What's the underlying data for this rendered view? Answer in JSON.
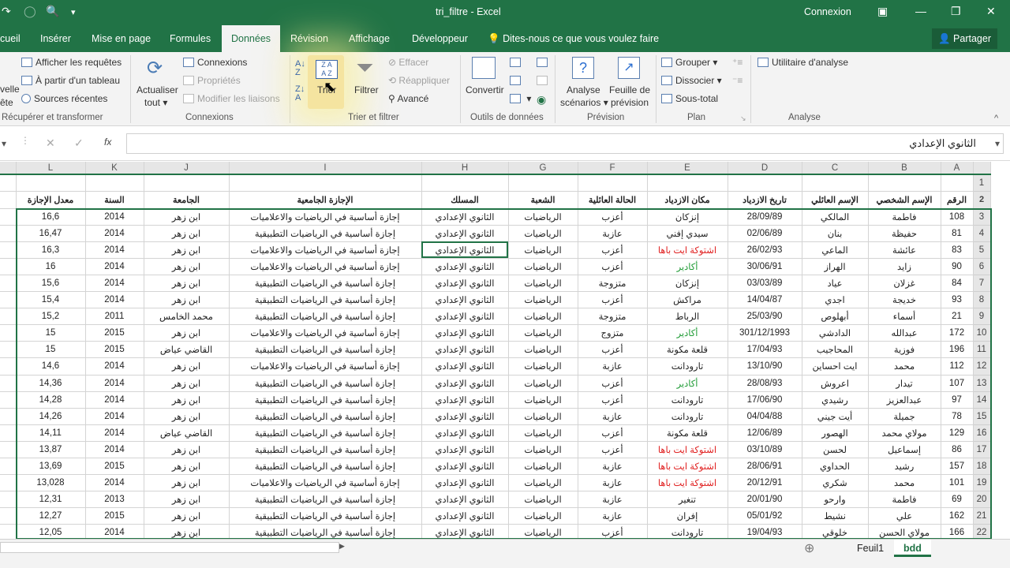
{
  "titlebar": {
    "doc_title": "tri_filtre  -  Excel",
    "signin": "Connexion"
  },
  "tabs": [
    "cueil",
    "Insérer",
    "Mise en page",
    "Formules",
    "Données",
    "Révision",
    "Affichage",
    "Développeur"
  ],
  "tell_me": "Dites-nous ce que vous voulez faire",
  "share": "Partager",
  "ribbon": {
    "nouvelle": "velle",
    "requete": "ête",
    "afficher_requetes": "Afficher les requêtes",
    "a_partir_tableau": "À partir d'un tableau",
    "sources_recentes": "Sources récentes",
    "actualiser": "Actualiser",
    "tout": "tout",
    "connexions": "Connexions",
    "proprietes": "Propriétés",
    "modifier_liaisons": "Modifier les liaisons",
    "trier": "Trier",
    "filtrer": "Filtrer",
    "effacer": "Effacer",
    "reappliquer": "Réappliquer",
    "avance": "Avancé",
    "convertir": "Convertir",
    "analyse": "Analyse",
    "scenarios": "scénarios",
    "feuille_de": "Feuille de",
    "prevision": "prévision",
    "grouper": "Grouper",
    "dissocier": "Dissocier",
    "sous_total": "Sous-total",
    "utilitaire": "Utilitaire d'analyse",
    "groups": {
      "recuperer": "Récupérer et transformer",
      "connexions": "Connexions",
      "trier_filtrer": "Trier et filtrer",
      "outils": "Outils de données",
      "prevision": "Prévision",
      "plan": "Plan",
      "analyse": "Analyse"
    }
  },
  "formula": {
    "fx": "fx",
    "value": "الثانوي الإعدادي"
  },
  "columns": [
    "L",
    "K",
    "J",
    "I",
    "H",
    "G",
    "F",
    "E",
    "D",
    "C",
    "B",
    "A"
  ],
  "headers": [
    "معدل الإجازة",
    "السنة",
    "الجامعة",
    "الإجازة الجامعية",
    "المسلك",
    "الشعبة",
    "الحالة العائلية",
    "مكان الازدياد",
    "تاريخ الازدياد",
    "الإسم العائلي",
    "الإسم الشخصي",
    "الرقم"
  ],
  "rows": [
    [
      "16,6",
      "2014",
      "ابن زهر",
      "إجازة أساسية في الرياضيات والاعلاميات",
      "الثانوي الإعدادي",
      "الرياضيات",
      "أعزب",
      "إنزكان",
      "28/09/89",
      "المالكي",
      "فاطمة",
      "108"
    ],
    [
      "16,47",
      "2014",
      "ابن زهر",
      "إجازة أساسية في الرياضيات التطبيقية",
      "الثانوي الإعدادي",
      "الرياضيات",
      "عازبة",
      "سيدي إفني",
      "02/06/89",
      "بنان",
      "حفيظة",
      "81"
    ],
    [
      "16,3",
      "2014",
      "ابن زهر",
      "إجازة أساسية في الرياضيات والاعلاميات",
      "الثانوي الإعدادي",
      "الرياضيات",
      "أعزب",
      "اشتوكة ايت باها",
      "26/02/93",
      "الماعي",
      "عائشة",
      "83"
    ],
    [
      "16",
      "2014",
      "ابن زهر",
      "إجازة أساسية في الرياضيات والاعلاميات",
      "الثانوي الإعدادي",
      "الرياضيات",
      "أعزب",
      "أكادير",
      "30/06/91",
      "الهراز",
      "زايد",
      "90"
    ],
    [
      "15,6",
      "2014",
      "ابن زهر",
      "إجازة أساسية في الرياضيات التطبيقية",
      "الثانوي الإعدادي",
      "الرياضيات",
      "متزوجة",
      "إنزكان",
      "03/03/89",
      "عياد",
      "غزلان",
      "84"
    ],
    [
      "15,4",
      "2014",
      "ابن زهر",
      "إجازة أساسية في الرياضيات التطبيقية",
      "الثانوي الإعدادي",
      "الرياضيات",
      "أعزب",
      "مراكش",
      "14/04/87",
      "اجدي",
      "خديجة",
      "93"
    ],
    [
      "15,2",
      "2011",
      "محمد الخامس",
      "إجازة أساسية في الرياضيات التطبيقية",
      "الثانوي الإعدادي",
      "الرياضيات",
      "متزوجة",
      "الرباط",
      "25/03/90",
      "أبهلوص",
      "أسماء",
      "21"
    ],
    [
      "15",
      "2015",
      "ابن زهر",
      "إجازة أساسية في الرياضيات والاعلاميات",
      "الثانوي الإعدادي",
      "الرياضيات",
      "متزوج",
      "أكادير",
      "301/12/1993",
      "الدادشي",
      "عبدالله",
      "172"
    ],
    [
      "15",
      "2015",
      "القاضي عياض",
      "إجازة أساسية في الرياضيات التطبيقية",
      "الثانوي الإعدادي",
      "الرياضيات",
      "أعزب",
      "قلعة مكونة",
      "17/04/93",
      "المحاجيب",
      "فوزية",
      "196"
    ],
    [
      "14,6",
      "2014",
      "ابن زهر",
      "إجازة أساسية في الرياضيات والاعلاميات",
      "الثانوي الإعدادي",
      "الرياضيات",
      "عازبة",
      "تارودانت",
      "13/10/90",
      "ايت احساين",
      "محمد",
      "112"
    ],
    [
      "14,36",
      "2014",
      "ابن زهر",
      "إجازة أساسية في الرياضيات التطبيقية",
      "الثانوي الإعدادي",
      "الرياضيات",
      "أعزب",
      "أكادير",
      "28/08/93",
      "اعروش",
      "تيدار",
      "107"
    ],
    [
      "14,28",
      "2014",
      "ابن زهر",
      "إجازة أساسية في الرياضيات التطبيقية",
      "الثانوي الإعدادي",
      "الرياضيات",
      "أعزب",
      "تارودانت",
      "17/06/90",
      "رشيدي",
      "عبدالعزيز",
      "97"
    ],
    [
      "14,26",
      "2014",
      "ابن زهر",
      "إجازة أساسية في الرياضيات التطبيقية",
      "الثانوي الإعدادي",
      "الرياضيات",
      "عازبة",
      "تارودانت",
      "04/04/88",
      "أيت جيني",
      "جميلة",
      "78"
    ],
    [
      "14,11",
      "2014",
      "القاضي عياض",
      "إجازة أساسية في الرياضيات التطبيقية",
      "الثانوي الإعدادي",
      "الرياضيات",
      "أعزب",
      "قلعة مكونة",
      "12/06/89",
      "الهصور",
      "مولاي محمد",
      "129"
    ],
    [
      "13,87",
      "2014",
      "ابن زهر",
      "إجازة أساسية في الرياضيات التطبيقية",
      "الثانوي الإعدادي",
      "الرياضيات",
      "أعزب",
      "اشتوكة ايت باها",
      "03/10/89",
      "لحسن",
      "إسماعيل",
      "86"
    ],
    [
      "13,69",
      "2015",
      "ابن زهر",
      "إجازة أساسية في الرياضيات التطبيقية",
      "الثانوي الإعدادي",
      "الرياضيات",
      "عازبة",
      "اشتوكة ايت باها",
      "28/06/91",
      "الحداوي",
      "رشيد",
      "157"
    ],
    [
      "13,028",
      "2014",
      "ابن زهر",
      "إجازة أساسية في الرياضيات والاعلاميات",
      "الثانوي الإعدادي",
      "الرياضيات",
      "عازبة",
      "اشتوكة ايت باها",
      "20/12/91",
      "شكري",
      "محمد",
      "101"
    ],
    [
      "12,31",
      "2013",
      "ابن زهر",
      "إجازة أساسية في الرياضيات التطبيقية",
      "الثانوي الإعدادي",
      "الرياضيات",
      "عازبة",
      "تنغير",
      "20/01/90",
      "وارحو",
      "فاطمة",
      "69"
    ],
    [
      "12,27",
      "2015",
      "ابن زهر",
      "إجازة أساسية في الرياضيات التطبيقية",
      "الثانوي الإعدادي",
      "الرياضيات",
      "عازبة",
      "إفران",
      "05/01/92",
      "نشيط",
      "علي",
      "162"
    ],
    [
      "12,05",
      "2014",
      "ابن زهر",
      "إجازة أساسية في الرياضيات التطبيقية",
      "الثانوي الإعدادي",
      "الرياضيات",
      "أعزب",
      "تارودانت",
      "19/04/93",
      "خلوقي",
      "مولاي الحسن",
      "166"
    ]
  ],
  "sheets": {
    "feuil1": "Feuil1",
    "bdd": "bdd"
  },
  "colors": {
    "excel_green": "#217346",
    "red_text": "#e02020",
    "green_text": "#1f9b35"
  }
}
